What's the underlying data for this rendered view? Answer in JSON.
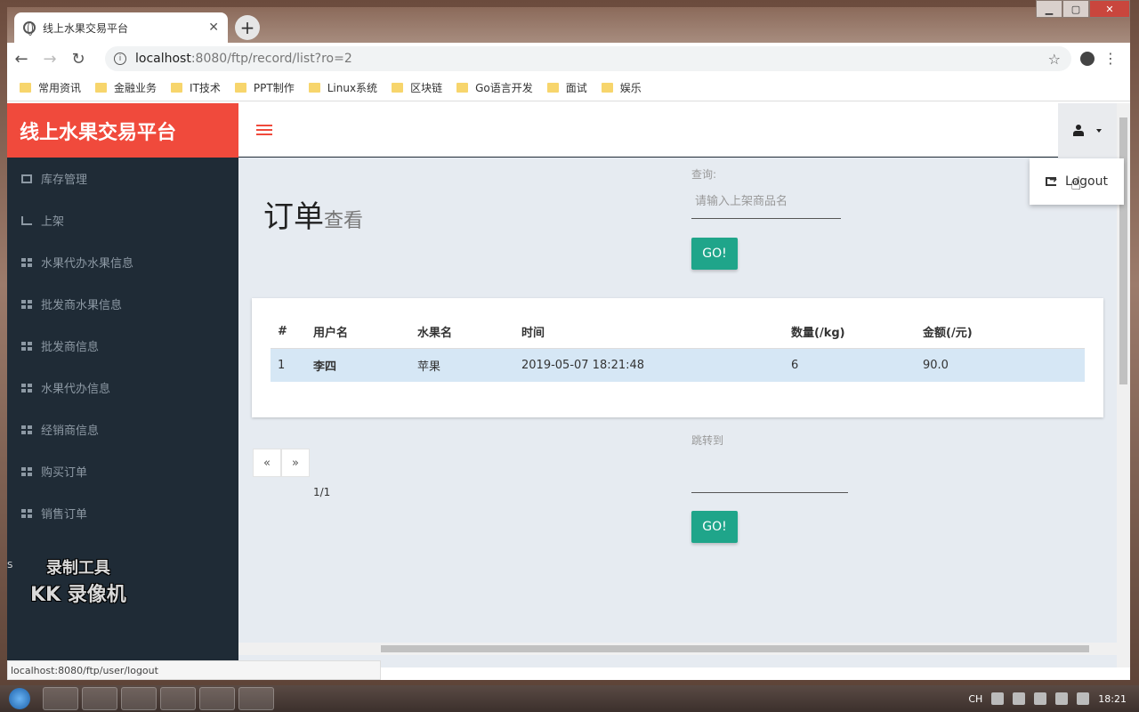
{
  "browser": {
    "tab_title": "线上水果交易平台",
    "url_host": "localhost",
    "url_path": ":8080/ftp/record/list?ro=2",
    "bookmarks": [
      "常用资讯",
      "金融业务",
      "IT技术",
      "PPT制作",
      "Linux系统",
      "区块链",
      "Go语言开发",
      "面试",
      "娱乐"
    ],
    "status_url": "localhost:8080/ftp/user/logout"
  },
  "app": {
    "brand": "线上水果交易平台",
    "sidebar": [
      {
        "label": "库存管理",
        "icon": "monitor-icon"
      },
      {
        "label": "上架",
        "icon": "bar-chart-icon"
      },
      {
        "label": "水果代办水果信息",
        "icon": "grid-icon"
      },
      {
        "label": "批发商水果信息",
        "icon": "grid-icon"
      },
      {
        "label": "批发商信息",
        "icon": "grid-icon"
      },
      {
        "label": "水果代办信息",
        "icon": "grid-icon"
      },
      {
        "label": "经销商信息",
        "icon": "grid-icon"
      },
      {
        "label": "购买订单",
        "icon": "grid-icon"
      },
      {
        "label": "销售订单",
        "icon": "grid-icon"
      }
    ],
    "user_menu": {
      "logout": "Logout"
    },
    "page": {
      "title": "订单",
      "subtitle": "查看"
    },
    "search": {
      "label": "查询:",
      "placeholder": "请输入上架商品名",
      "button": "GO!"
    },
    "table": {
      "headers": [
        "#",
        "用户名",
        "水果名",
        "时间",
        "数量(/kg)",
        "金额(/元)"
      ],
      "rows": [
        [
          "1",
          "李四",
          "苹果",
          "2019-05-07 18:21:48",
          "6",
          "90.0"
        ]
      ]
    },
    "pagination": {
      "prev": "«",
      "next": "»",
      "count": "1/1"
    },
    "jump": {
      "label": "跳转到",
      "button": "GO!"
    }
  },
  "watermark": {
    "line1": "录制工具",
    "line2": "KK 录像机"
  },
  "sidebar_stray": "S",
  "taskbar": {
    "time": "18:21",
    "lang": "CH"
  },
  "colors": {
    "brand": "#f04a3c",
    "sidebar": "#1f2b36",
    "button": "#1fa58a",
    "row_highlight": "#d6e7f5"
  }
}
